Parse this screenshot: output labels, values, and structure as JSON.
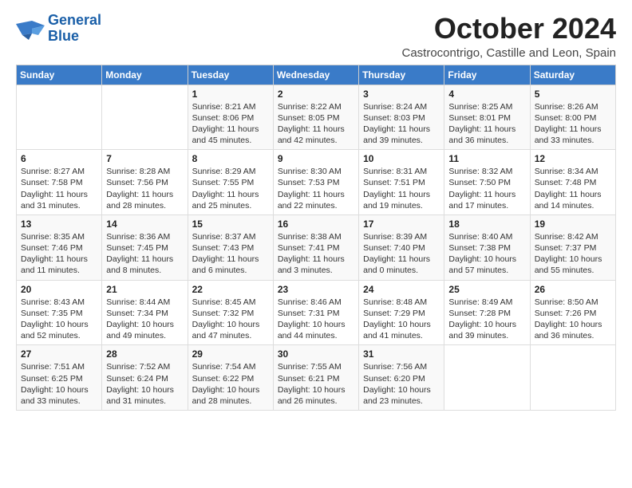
{
  "logo": {
    "line1": "General",
    "line2": "Blue"
  },
  "title": "October 2024",
  "subtitle": "Castrocontrigo, Castille and Leon, Spain",
  "weekdays": [
    "Sunday",
    "Monday",
    "Tuesday",
    "Wednesday",
    "Thursday",
    "Friday",
    "Saturday"
  ],
  "weeks": [
    [
      {
        "day": null
      },
      {
        "day": null
      },
      {
        "day": "1",
        "sunrise": "Sunrise: 8:21 AM",
        "sunset": "Sunset: 8:06 PM",
        "daylight": "Daylight: 11 hours and 45 minutes."
      },
      {
        "day": "2",
        "sunrise": "Sunrise: 8:22 AM",
        "sunset": "Sunset: 8:05 PM",
        "daylight": "Daylight: 11 hours and 42 minutes."
      },
      {
        "day": "3",
        "sunrise": "Sunrise: 8:24 AM",
        "sunset": "Sunset: 8:03 PM",
        "daylight": "Daylight: 11 hours and 39 minutes."
      },
      {
        "day": "4",
        "sunrise": "Sunrise: 8:25 AM",
        "sunset": "Sunset: 8:01 PM",
        "daylight": "Daylight: 11 hours and 36 minutes."
      },
      {
        "day": "5",
        "sunrise": "Sunrise: 8:26 AM",
        "sunset": "Sunset: 8:00 PM",
        "daylight": "Daylight: 11 hours and 33 minutes."
      }
    ],
    [
      {
        "day": "6",
        "sunrise": "Sunrise: 8:27 AM",
        "sunset": "Sunset: 7:58 PM",
        "daylight": "Daylight: 11 hours and 31 minutes."
      },
      {
        "day": "7",
        "sunrise": "Sunrise: 8:28 AM",
        "sunset": "Sunset: 7:56 PM",
        "daylight": "Daylight: 11 hours and 28 minutes."
      },
      {
        "day": "8",
        "sunrise": "Sunrise: 8:29 AM",
        "sunset": "Sunset: 7:55 PM",
        "daylight": "Daylight: 11 hours and 25 minutes."
      },
      {
        "day": "9",
        "sunrise": "Sunrise: 8:30 AM",
        "sunset": "Sunset: 7:53 PM",
        "daylight": "Daylight: 11 hours and 22 minutes."
      },
      {
        "day": "10",
        "sunrise": "Sunrise: 8:31 AM",
        "sunset": "Sunset: 7:51 PM",
        "daylight": "Daylight: 11 hours and 19 minutes."
      },
      {
        "day": "11",
        "sunrise": "Sunrise: 8:32 AM",
        "sunset": "Sunset: 7:50 PM",
        "daylight": "Daylight: 11 hours and 17 minutes."
      },
      {
        "day": "12",
        "sunrise": "Sunrise: 8:34 AM",
        "sunset": "Sunset: 7:48 PM",
        "daylight": "Daylight: 11 hours and 14 minutes."
      }
    ],
    [
      {
        "day": "13",
        "sunrise": "Sunrise: 8:35 AM",
        "sunset": "Sunset: 7:46 PM",
        "daylight": "Daylight: 11 hours and 11 minutes."
      },
      {
        "day": "14",
        "sunrise": "Sunrise: 8:36 AM",
        "sunset": "Sunset: 7:45 PM",
        "daylight": "Daylight: 11 hours and 8 minutes."
      },
      {
        "day": "15",
        "sunrise": "Sunrise: 8:37 AM",
        "sunset": "Sunset: 7:43 PM",
        "daylight": "Daylight: 11 hours and 6 minutes."
      },
      {
        "day": "16",
        "sunrise": "Sunrise: 8:38 AM",
        "sunset": "Sunset: 7:41 PM",
        "daylight": "Daylight: 11 hours and 3 minutes."
      },
      {
        "day": "17",
        "sunrise": "Sunrise: 8:39 AM",
        "sunset": "Sunset: 7:40 PM",
        "daylight": "Daylight: 11 hours and 0 minutes."
      },
      {
        "day": "18",
        "sunrise": "Sunrise: 8:40 AM",
        "sunset": "Sunset: 7:38 PM",
        "daylight": "Daylight: 10 hours and 57 minutes."
      },
      {
        "day": "19",
        "sunrise": "Sunrise: 8:42 AM",
        "sunset": "Sunset: 7:37 PM",
        "daylight": "Daylight: 10 hours and 55 minutes."
      }
    ],
    [
      {
        "day": "20",
        "sunrise": "Sunrise: 8:43 AM",
        "sunset": "Sunset: 7:35 PM",
        "daylight": "Daylight: 10 hours and 52 minutes."
      },
      {
        "day": "21",
        "sunrise": "Sunrise: 8:44 AM",
        "sunset": "Sunset: 7:34 PM",
        "daylight": "Daylight: 10 hours and 49 minutes."
      },
      {
        "day": "22",
        "sunrise": "Sunrise: 8:45 AM",
        "sunset": "Sunset: 7:32 PM",
        "daylight": "Daylight: 10 hours and 47 minutes."
      },
      {
        "day": "23",
        "sunrise": "Sunrise: 8:46 AM",
        "sunset": "Sunset: 7:31 PM",
        "daylight": "Daylight: 10 hours and 44 minutes."
      },
      {
        "day": "24",
        "sunrise": "Sunrise: 8:48 AM",
        "sunset": "Sunset: 7:29 PM",
        "daylight": "Daylight: 10 hours and 41 minutes."
      },
      {
        "day": "25",
        "sunrise": "Sunrise: 8:49 AM",
        "sunset": "Sunset: 7:28 PM",
        "daylight": "Daylight: 10 hours and 39 minutes."
      },
      {
        "day": "26",
        "sunrise": "Sunrise: 8:50 AM",
        "sunset": "Sunset: 7:26 PM",
        "daylight": "Daylight: 10 hours and 36 minutes."
      }
    ],
    [
      {
        "day": "27",
        "sunrise": "Sunrise: 7:51 AM",
        "sunset": "Sunset: 6:25 PM",
        "daylight": "Daylight: 10 hours and 33 minutes."
      },
      {
        "day": "28",
        "sunrise": "Sunrise: 7:52 AM",
        "sunset": "Sunset: 6:24 PM",
        "daylight": "Daylight: 10 hours and 31 minutes."
      },
      {
        "day": "29",
        "sunrise": "Sunrise: 7:54 AM",
        "sunset": "Sunset: 6:22 PM",
        "daylight": "Daylight: 10 hours and 28 minutes."
      },
      {
        "day": "30",
        "sunrise": "Sunrise: 7:55 AM",
        "sunset": "Sunset: 6:21 PM",
        "daylight": "Daylight: 10 hours and 26 minutes."
      },
      {
        "day": "31",
        "sunrise": "Sunrise: 7:56 AM",
        "sunset": "Sunset: 6:20 PM",
        "daylight": "Daylight: 10 hours and 23 minutes."
      },
      {
        "day": null
      },
      {
        "day": null
      }
    ]
  ]
}
